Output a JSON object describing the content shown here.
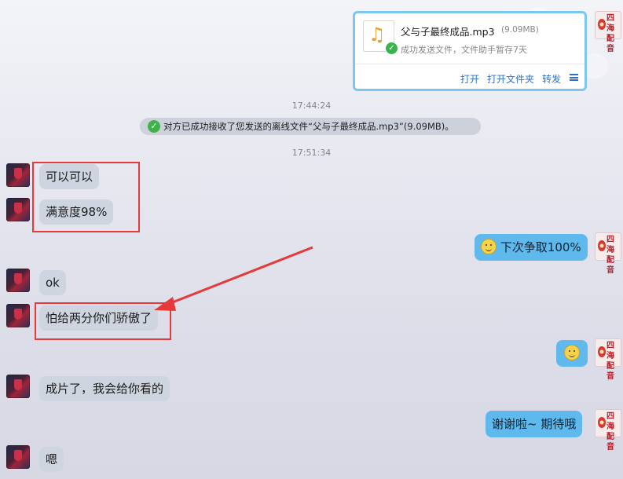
{
  "file_card": {
    "file_name": "父与子最终成品.mp3",
    "file_size": "(9.09MB)",
    "status": "成功发送文件，文件助手暂存7天",
    "actions": [
      "打开",
      "打开文件夹",
      "转发"
    ],
    "icon": "music-file-icon"
  },
  "times": [
    "17:44:24",
    "17:51:34"
  ],
  "system_notice": "对方已成功接收了您发送的离线文件“父与子最终成品.mp3”(9.09MB)。",
  "avatar_right_text": [
    "四海",
    "配音"
  ],
  "messages_left": [
    "可以可以",
    "满意度98%",
    "ok",
    "怕给两分你们骄傲了",
    "成片了，我会给你看的",
    "嗯"
  ],
  "messages_right": [
    "下次争取100%",
    "谢谢啦~ 期待哦"
  ],
  "colors": {
    "bubble_left": "#ced5e0",
    "bubble_right": "#5fb9ec",
    "highlight": "#e5393a",
    "link": "#2b71c9"
  }
}
